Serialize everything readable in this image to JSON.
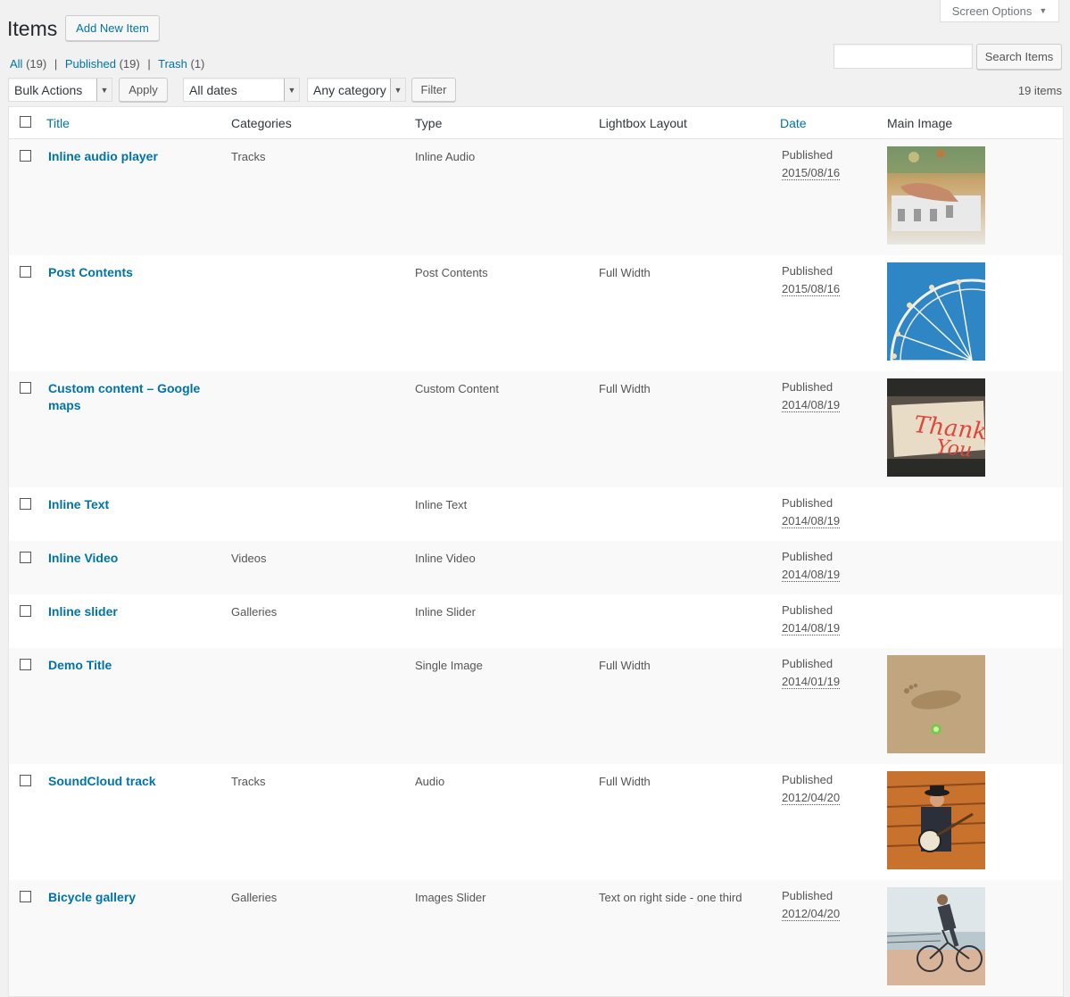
{
  "screen_options": {
    "label": "Screen Options"
  },
  "header": {
    "title": "Items",
    "add_new_label": "Add New Item"
  },
  "views": {
    "all_label": "All",
    "all_count": "(19)",
    "published_label": "Published",
    "published_count": "(19)",
    "trash_label": "Trash",
    "trash_count": "(1)"
  },
  "search": {
    "button_label": "Search Items",
    "value": ""
  },
  "tablenav": {
    "bulk_actions": "Bulk Actions",
    "apply_label": "Apply",
    "dates": "All dates",
    "category": "Any category",
    "filter_label": "Filter",
    "item_count": "19 items"
  },
  "columns": {
    "title": "Title",
    "categories": "Categories",
    "type": "Type",
    "lightbox": "Lightbox Layout",
    "date": "Date",
    "main_image": "Main Image"
  },
  "rows": [
    {
      "title": "Inline audio player",
      "categories": "Tracks",
      "type": "Inline Audio",
      "lightbox": "",
      "status": "Published",
      "date": "2015/08/16",
      "image": "dj-mixer-photo"
    },
    {
      "title": "Post Contents",
      "categories": "",
      "type": "Post Contents",
      "lightbox": "Full Width",
      "status": "Published",
      "date": "2015/08/16",
      "image": "ferris-wheel-photo"
    },
    {
      "title": "Custom content – Google maps",
      "categories": "",
      "type": "Custom Content",
      "lightbox": "Full Width",
      "status": "Published",
      "date": "2014/08/19",
      "image": "neon-sign-photo"
    },
    {
      "title": "Inline Text",
      "categories": "",
      "type": "Inline Text",
      "lightbox": "",
      "status": "Published",
      "date": "2014/08/19",
      "image": ""
    },
    {
      "title": "Inline Video",
      "categories": "Videos",
      "type": "Inline Video",
      "lightbox": "",
      "status": "Published",
      "date": "2014/08/19",
      "image": ""
    },
    {
      "title": "Inline slider",
      "categories": "Galleries",
      "type": "Inline Slider",
      "lightbox": "",
      "status": "Published",
      "date": "2014/08/19",
      "image": ""
    },
    {
      "title": "Demo Title",
      "categories": "",
      "type": "Single Image",
      "lightbox": "Full Width",
      "status": "Published",
      "date": "2014/01/19",
      "image": "footprint-sand-photo"
    },
    {
      "title": "SoundCloud track",
      "categories": "Tracks",
      "type": "Audio",
      "lightbox": "Full Width",
      "status": "Published",
      "date": "2012/04/20",
      "image": "banjo-player-photo"
    },
    {
      "title": "Bicycle gallery",
      "categories": "Galleries",
      "type": "Images Slider",
      "lightbox": "Text on right side - one third",
      "status": "Published",
      "date": "2012/04/20",
      "image": "cyclist-photo"
    }
  ],
  "colors": {
    "link": "#0073aa",
    "background": "#f1f1f1",
    "row_alt": "#f9f9f9"
  }
}
